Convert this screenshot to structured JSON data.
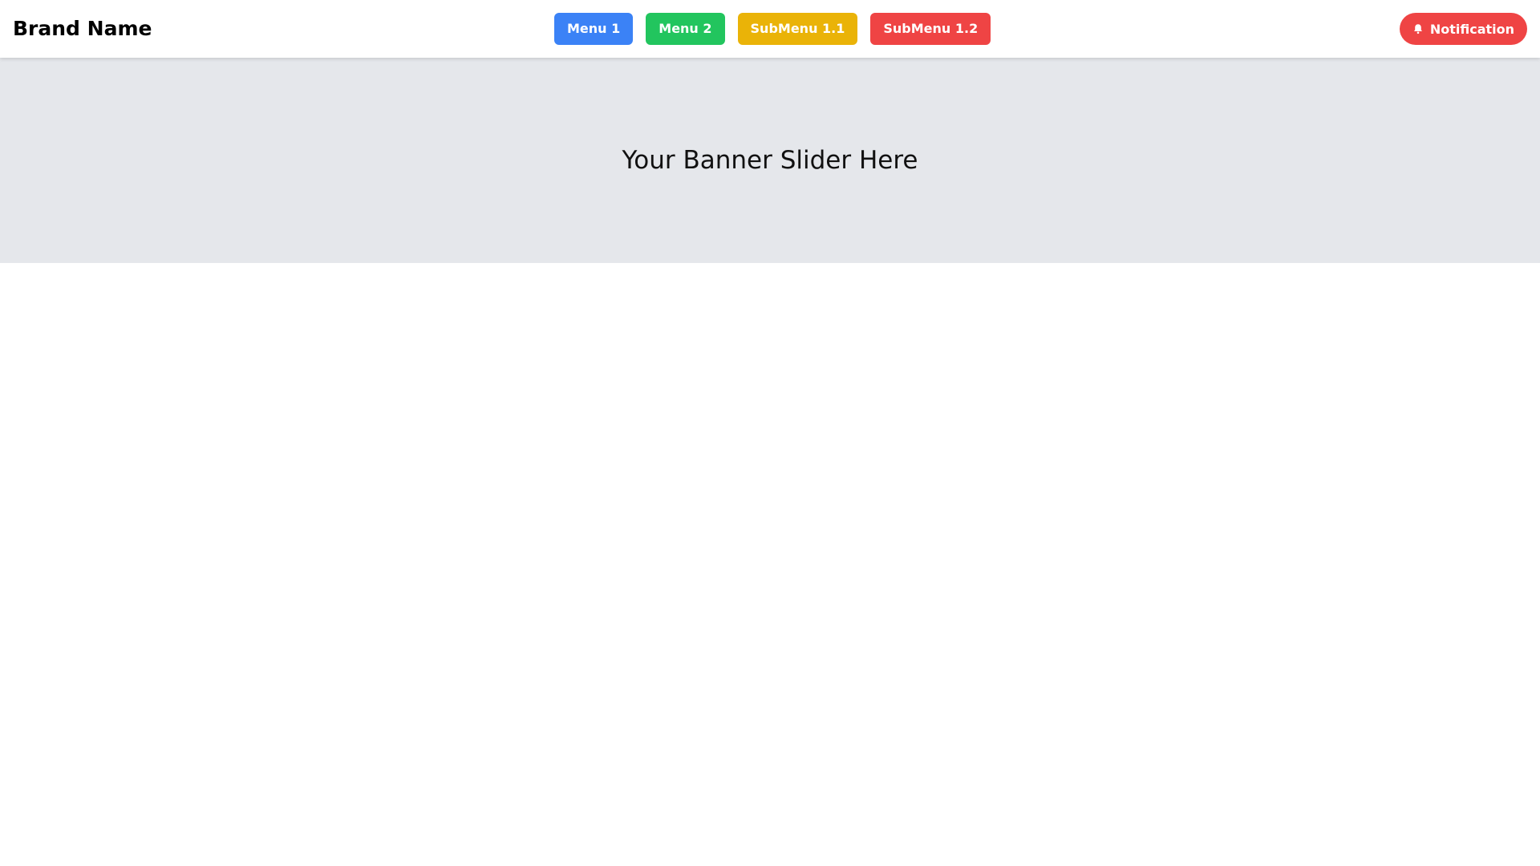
{
  "header": {
    "brand": "Brand Name",
    "menu": [
      {
        "label": "Menu 1",
        "color": "#3b82f6"
      },
      {
        "label": "Menu 2",
        "color": "#22c55e"
      },
      {
        "label": "SubMenu 1.1",
        "color": "#eab308"
      },
      {
        "label": "SubMenu 1.2",
        "color": "#ef4444"
      }
    ],
    "notification": {
      "label": "Notification",
      "color": "#ef4444",
      "icon": "bell-icon"
    }
  },
  "banner": {
    "text": "Your Banner Slider Here",
    "background": "#e5e7eb"
  }
}
